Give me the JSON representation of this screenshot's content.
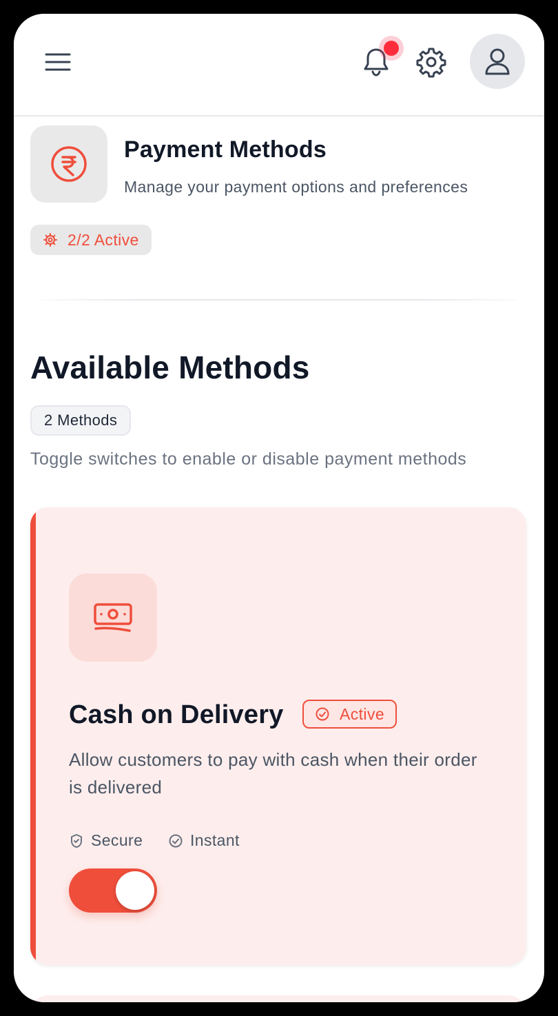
{
  "header": {
    "icons": [
      "hamburger-menu-icon",
      "bell-icon",
      "gear-icon",
      "user-icon"
    ],
    "notification_dot_color": "#ff2d3b"
  },
  "page": {
    "icon": "rupee-icon",
    "title": "Payment Methods",
    "subtitle": "Manage your payment options and preferences",
    "active_status": "2/2 Active"
  },
  "section": {
    "title": "Available Methods",
    "count_label": "2 Methods",
    "hint": "Toggle switches to enable or disable payment methods"
  },
  "methods": [
    {
      "icon": "cash-icon",
      "name": "Cash on Delivery",
      "status": "Active",
      "description": "Allow customers to pay with cash when their order is delivered",
      "features": [
        "Secure",
        "Instant"
      ],
      "enabled": true
    }
  ],
  "colors": {
    "accent": "#ef4e3b",
    "card_bg": "#fdeeed",
    "title_text": "#111827",
    "muted_text": "#6b7280"
  }
}
